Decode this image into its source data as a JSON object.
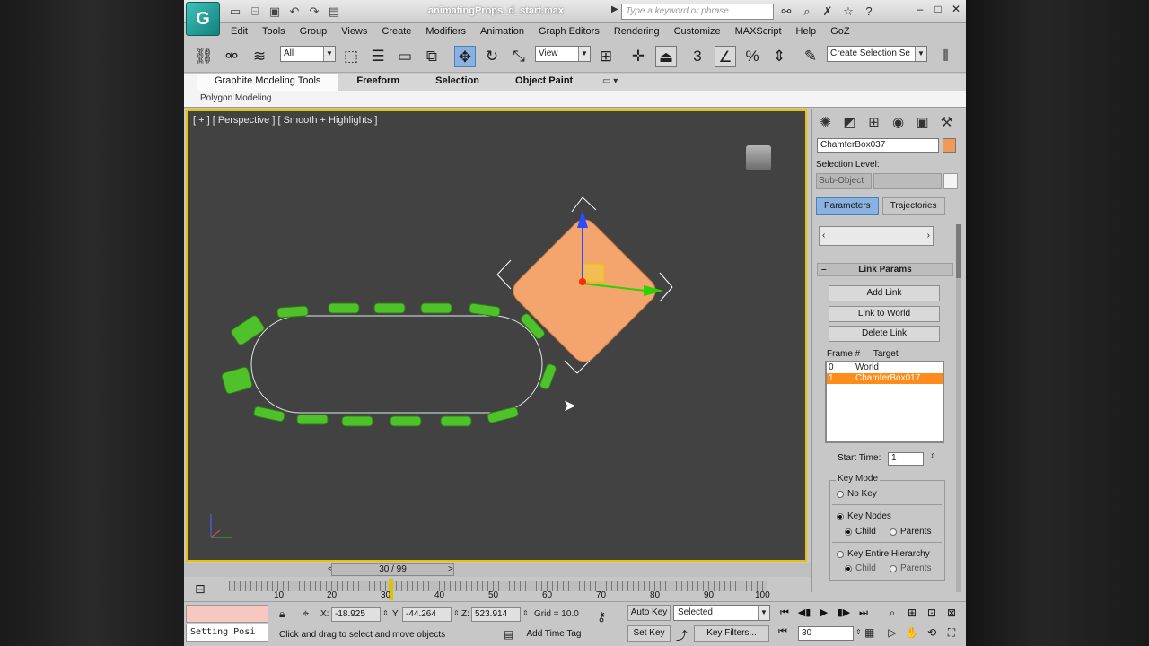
{
  "window": {
    "title": "animatingProps_d_start.max",
    "search_placeholder": "Type a keyword or phrase",
    "app_logo": "3ds-max-logo"
  },
  "menu": [
    "Edit",
    "Tools",
    "Group",
    "Views",
    "Create",
    "Modifiers",
    "Animation",
    "Graph Editors",
    "Rendering",
    "Customize",
    "MAXScript",
    "Help",
    "GoZ"
  ],
  "toolbar": {
    "filter_dropdown": "All",
    "ref_coord_dropdown": "View",
    "snap_label": "3",
    "named_selection": "Create Selection Se"
  },
  "ribbon": {
    "tabs": [
      "Graphite Modeling Tools",
      "Freeform",
      "Selection",
      "Object Paint"
    ],
    "sub_label": "Polygon Modeling"
  },
  "viewport": {
    "label": "[ + ] [ Perspective ] [ Smooth + Highlights ]"
  },
  "command_panel": {
    "object_name": "ChamferBox037",
    "object_color": "#f09a5a",
    "selection_level_label": "Selection Level:",
    "sub_object_label": "Sub-Object",
    "tabs": [
      "Parameters",
      "Trajectories"
    ],
    "link_params": {
      "title": "Link Params",
      "buttons": [
        "Add Link",
        "Link to World",
        "Delete Link"
      ],
      "frame_header": "Frame #",
      "target_header": "Target",
      "rows": [
        {
          "frame": "0",
          "target": "World"
        },
        {
          "frame": "1",
          "target": "ChamferBox017"
        }
      ],
      "start_time_label": "Start Time:",
      "start_time_value": "1",
      "key_mode_label": "Key Mode",
      "no_key": "No Key",
      "key_nodes": "Key Nodes",
      "child": "Child",
      "parents": "Parents",
      "key_entire_hierarchy": "Key Entire Hierarchy"
    }
  },
  "timeline": {
    "frame_display": "30 / 99",
    "ticks": [
      "10",
      "20",
      "30",
      "40",
      "50",
      "60",
      "70",
      "80",
      "90",
      "100"
    ],
    "current_frame": 30,
    "max_frame": 100
  },
  "status": {
    "maxscript_output": "Setting Posi",
    "x_label": "X:",
    "x_value": "-18.925",
    "y_label": "Y:",
    "y_value": "-44.264",
    "z_label": "Z:",
    "z_value": "523.914",
    "grid": "Grid = 10.0",
    "prompt": "Click and drag to select and move objects",
    "add_time_tag": "Add Time Tag",
    "auto_key": "Auto Key",
    "set_key": "Set Key",
    "selected_dropdown": "Selected",
    "key_filters": "Key Filters...",
    "current_frame_field": "30"
  },
  "colors": {
    "viewport_border": "#e8c400",
    "object_orange": "#f4a56e",
    "chain_green": "#4fc12a",
    "selected_row": "#ff8c1a"
  }
}
